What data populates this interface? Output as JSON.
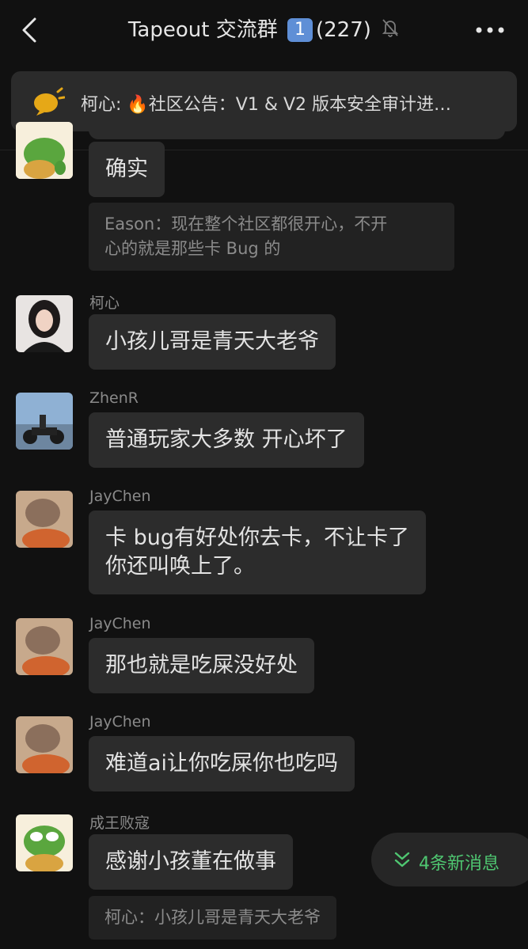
{
  "header": {
    "title": "Tapeout 交流群",
    "badge": "1",
    "member_count": "(227)",
    "icons": [
      "back-chevron-icon",
      "mute-bell-icon",
      "more-dots-icon"
    ]
  },
  "announcement": {
    "text": "柯心: 🔥社区公告：V1 & V2 版本安全审计进…",
    "icon": "megaphone-icon"
  },
  "messages": [
    {
      "sender": "",
      "text": "确实",
      "quote": "Eason：现在整个社区都很开心，不开\n心的就是那些卡 Bug 的",
      "avatar": "frog-avatar"
    },
    {
      "sender": "柯心",
      "text": "小孩儿哥是青天大老爷",
      "avatar": "woman-avatar"
    },
    {
      "sender": "ZhenR",
      "text": "普通玩家大多数 开心坏了",
      "avatar": "motorcycle-avatar"
    },
    {
      "sender": "JayChen",
      "text": "卡 bug有好处你去卡，不让卡了\n你还叫唤上了。",
      "avatar": "blurred-avatar"
    },
    {
      "sender": "JayChen",
      "text": "那也就是吃屎没好处",
      "avatar": "blurred-avatar"
    },
    {
      "sender": "JayChen",
      "text": "难道ai让你吃屎你也吃吗",
      "avatar": "blurred-avatar"
    },
    {
      "sender": "成王败寇",
      "text": "感谢小孩董在做事",
      "quote": "柯心：小孩儿哥是青天大老爷",
      "avatar": "frog-avatar"
    }
  ],
  "new_messages_button": {
    "label": "4条新消息",
    "icon": "double-chevron-down-icon"
  },
  "colors": {
    "background": "#111111",
    "bubble": "#2c2c2c",
    "accent_green": "#4fc771",
    "badge_blue": "#5f8fd6"
  }
}
